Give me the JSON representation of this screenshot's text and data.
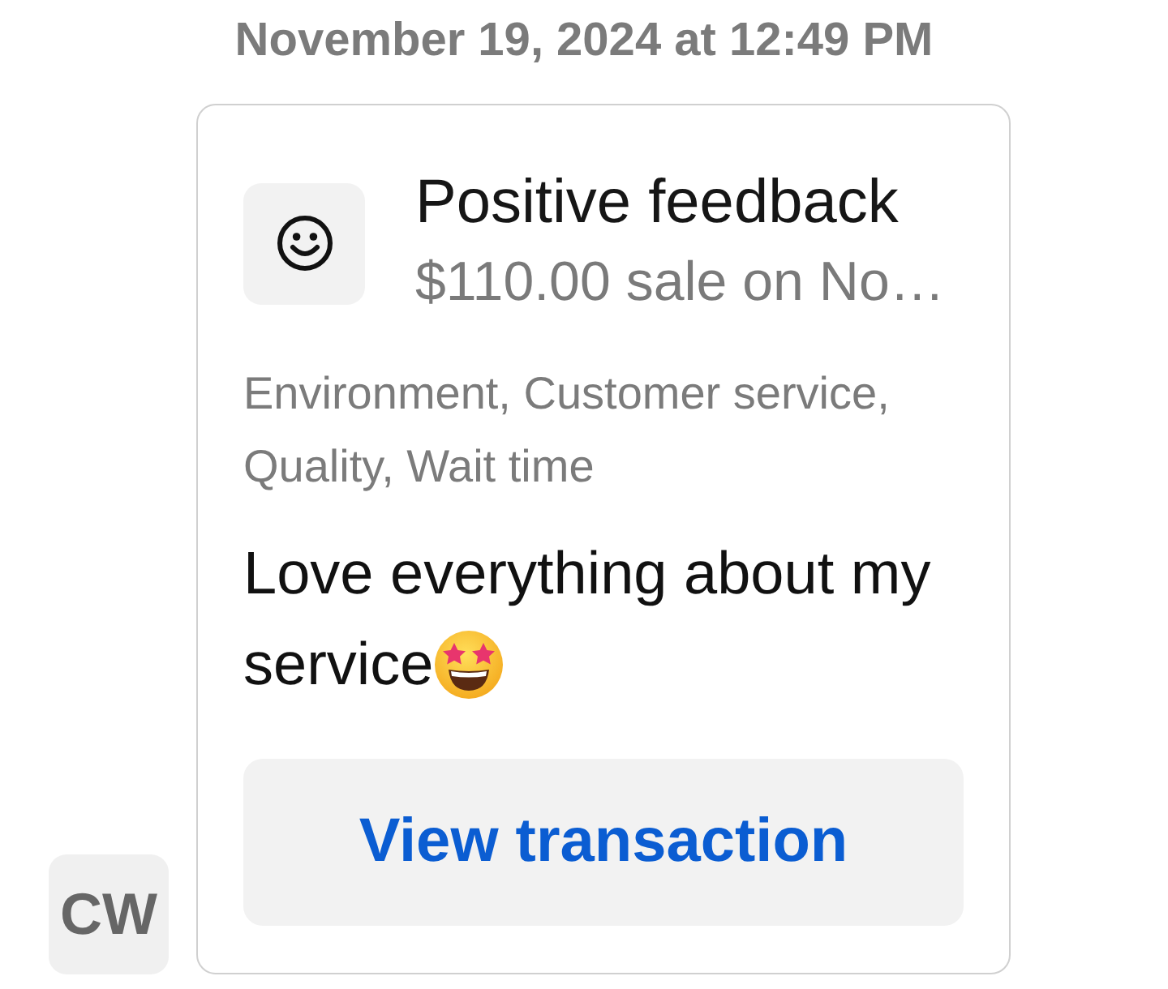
{
  "timestamp": "November 19, 2024 at 12:49 PM",
  "sender": {
    "initials": "CW"
  },
  "card": {
    "title": "Positive feedback",
    "subtitle": "$110.00 sale on No…",
    "tags": "Environment, Customer service, Quality, Wait time",
    "message_lines": [
      "Love everything about my",
      "service"
    ],
    "action": "View transaction"
  }
}
